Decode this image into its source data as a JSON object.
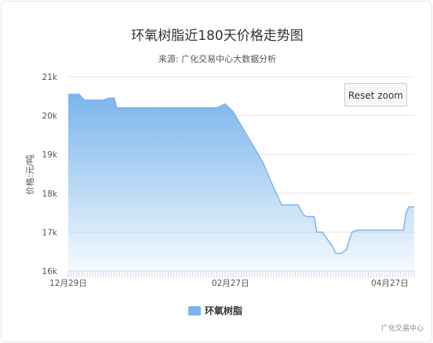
{
  "chart_data": {
    "type": "area",
    "title": "环氧树脂近180天价格走势图",
    "subtitle": "来源: 广化交易中心大数据分析",
    "ylabel": "价格:元/吨",
    "xlabel": "",
    "ylim": [
      16000,
      21000
    ],
    "yticks": [
      "16k",
      "17k",
      "18k",
      "19k",
      "20k",
      "21k"
    ],
    "ytick_values": [
      16000,
      17000,
      18000,
      19000,
      20000,
      21000
    ],
    "xticks": [
      "12月29日",
      "02月27日",
      "04月27日"
    ],
    "xtick_days": [
      0,
      60,
      119
    ],
    "x_range_days": [
      0,
      128
    ],
    "grid": true,
    "legend_position": "bottom-center",
    "series": [
      {
        "name": "环氧树脂",
        "color": "#7cb5ec",
        "points": [
          [
            0,
            20550
          ],
          [
            4,
            20550
          ],
          [
            6,
            20400
          ],
          [
            13,
            20400
          ],
          [
            15,
            20450
          ],
          [
            17,
            20450
          ],
          [
            18,
            20200
          ],
          [
            30,
            20200
          ],
          [
            40,
            20200
          ],
          [
            55,
            20200
          ],
          [
            58,
            20300
          ],
          [
            61,
            20100
          ],
          [
            72,
            18800
          ],
          [
            75,
            18300
          ],
          [
            77,
            18000
          ],
          [
            79,
            17700
          ],
          [
            85,
            17700
          ],
          [
            87,
            17450
          ],
          [
            88,
            17400
          ],
          [
            91,
            17400
          ],
          [
            92,
            17000
          ],
          [
            94,
            17000
          ],
          [
            96,
            16800
          ],
          [
            98,
            16600
          ],
          [
            99,
            16450
          ],
          [
            101,
            16450
          ],
          [
            103,
            16550
          ],
          [
            104,
            16800
          ],
          [
            105,
            17000
          ],
          [
            107,
            17050
          ],
          [
            118,
            17050
          ],
          [
            124,
            17050
          ],
          [
            125,
            17500
          ],
          [
            126,
            17650
          ],
          [
            128,
            17650
          ]
        ]
      }
    ]
  },
  "reset_zoom_label": "Reset zoom",
  "credit": "广化交易中心"
}
